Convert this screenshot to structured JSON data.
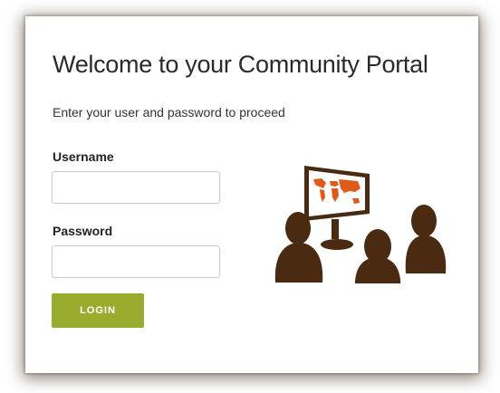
{
  "portal": {
    "title": "Welcome to your Community Portal",
    "subtitle": "Enter your user and password to proceed"
  },
  "form": {
    "username_label": "Username",
    "username_value": "",
    "password_label": "Password",
    "password_value": "",
    "login_label": "LOGIN"
  },
  "illustration": {
    "icon": "community-computer-icon",
    "figure_color": "#4a2a10",
    "map_color": "#e05a1a"
  },
  "colors": {
    "button": "#9aac2e"
  }
}
